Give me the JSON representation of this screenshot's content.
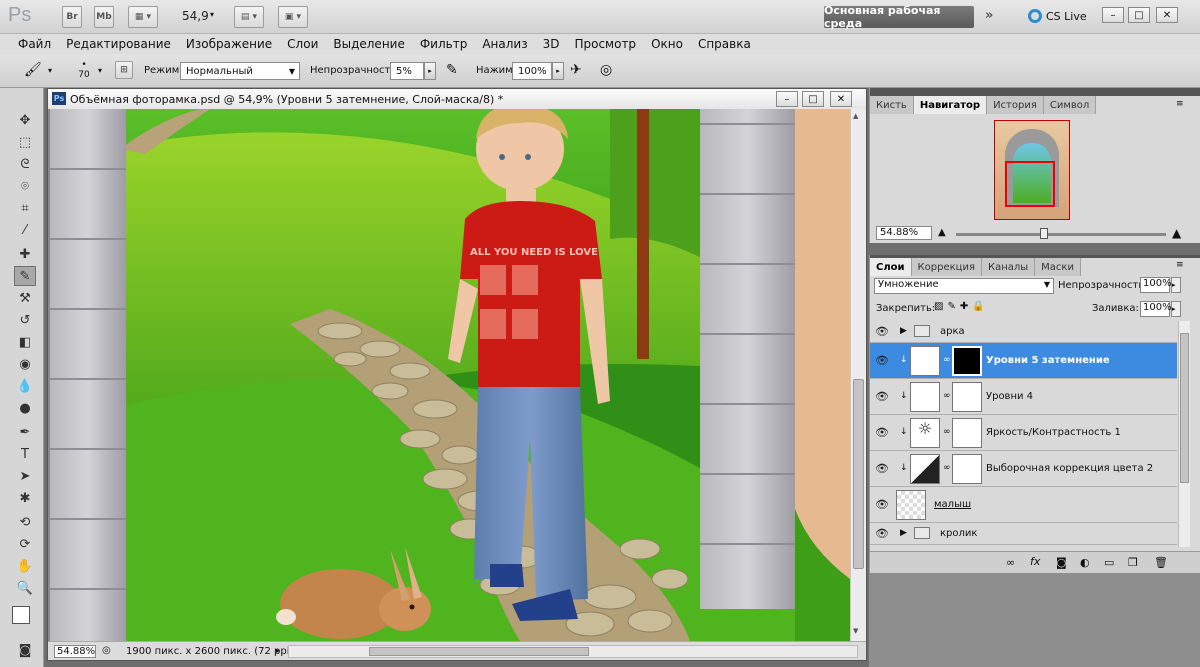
{
  "app": {
    "logo": "Ps",
    "bridge_label": "Br",
    "minibridge_label": "Mb",
    "zoom_value": "54,9",
    "workspace_label": "Основная рабочая среда",
    "cslive_label": "CS Live",
    "window_controls": [
      "–",
      "□",
      "✕"
    ]
  },
  "menu": [
    "Файл",
    "Редактирование",
    "Изображение",
    "Слои",
    "Выделение",
    "Фильтр",
    "Анализ",
    "3D",
    "Просмотр",
    "Окно",
    "Справка"
  ],
  "options": {
    "brush_size": "70",
    "mode_label": "Режим:",
    "mode_value": "Нормальный",
    "opacity_label": "Непрозрачность:",
    "opacity_value": "5%",
    "flow_label": "Нажим:",
    "flow_value": "100%"
  },
  "document": {
    "title": "Объёмная фоторамка.psd @ 54,9% (Уровни 5 затемнение, Слой-маска/8) *",
    "status_zoom": "54.88%",
    "status_info": "1900 пикс. x 2600 пикс. (72 ppi)"
  },
  "navigator": {
    "tabs": [
      "Кисть",
      "Навигатор",
      "История",
      "Символ"
    ],
    "active_tab": "Навигатор",
    "zoom": "54.88%"
  },
  "layers_panel": {
    "tabs": [
      "Слои",
      "Коррекция",
      "Каналы",
      "Маски"
    ],
    "blend_mode": "Умножение",
    "opacity_label": "Непрозрачность:",
    "opacity_value": "100%",
    "lock_label": "Закрепить:",
    "fill_label": "Заливка:",
    "fill_value": "100%",
    "layers": [
      {
        "name": "арка",
        "kind": "group"
      },
      {
        "name": "Уровни 5 затемнение",
        "kind": "adjustment",
        "selected": true
      },
      {
        "name": "Уровни 4",
        "kind": "adjustment"
      },
      {
        "name": "Яркость/Контрастность 1",
        "kind": "adjustment"
      },
      {
        "name": "Выборочная коррекция цвета 2",
        "kind": "adjustment"
      },
      {
        "name": "малыш",
        "kind": "pixel"
      },
      {
        "name": "кролик",
        "kind": "group"
      }
    ]
  },
  "colors": {
    "selection": "#3d8be0",
    "tshirt": "#cc1a14",
    "grass": "#5cbf1e"
  }
}
